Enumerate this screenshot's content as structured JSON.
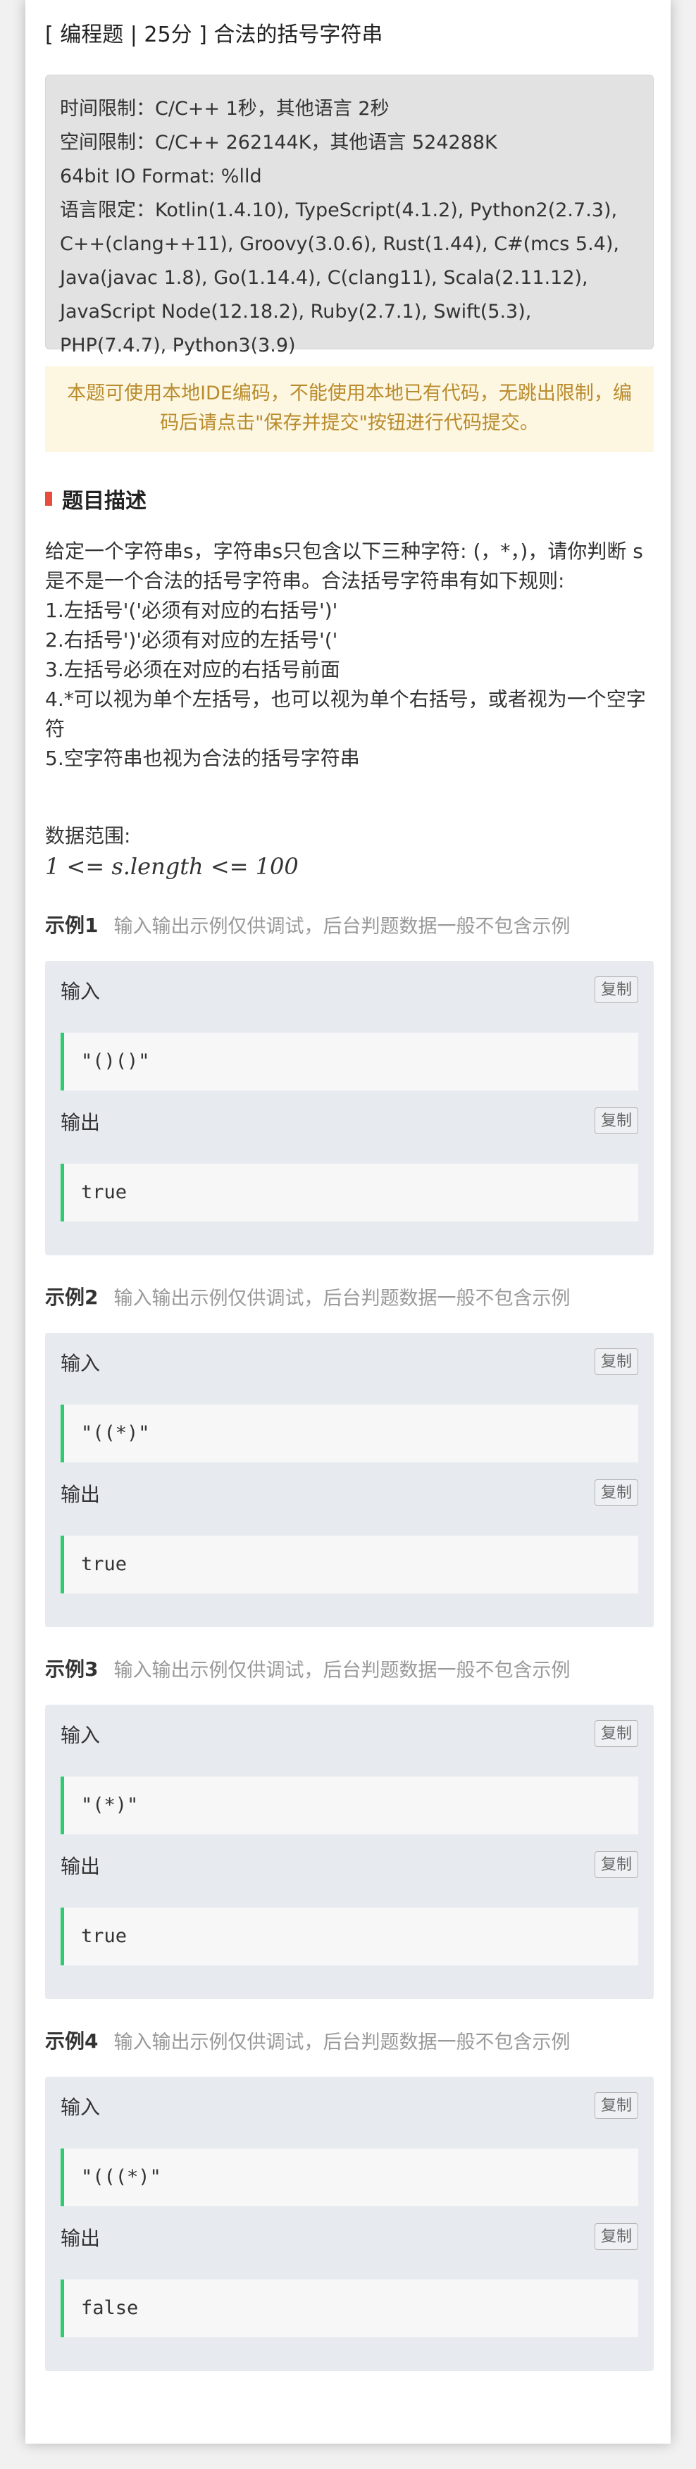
{
  "title": "[ 编程题 | 25分 ] 合法的括号字符串",
  "limits": [
    "时间限制：C/C++ 1秒，其他语言 2秒",
    "空间限制：C/C++ 262144K，其他语言 524288K",
    "64bit IO Format: %lld",
    "语言限定：Kotlin(1.4.10), TypeScript(4.1.2), Python2(2.7.3), C++(clang++11), Groovy(3.0.6), Rust(1.44), C#(mcs 5.4), Java(javac 1.8), Go(1.14.4), C(clang11), Scala(2.11.12), JavaScript Node(12.18.2), Ruby(2.7.1), Swift(5.3), PHP(7.4.7), Python3(3.9)"
  ],
  "notice": "本题可使用本地IDE编码，不能使用本地已有代码，无跳出限制，编码后请点击\"保存并提交\"按钮进行代码提交。",
  "section_title": "题目描述",
  "description": [
    "给定一个字符串s，字符串s只包含以下三种字符: (，*，)，请你判断 s是不是一个合法的括号字符串。合法括号字符串有如下规则:",
    "1.左括号'('必须有对应的右括号')'",
    "2.右括号')'必须有对应的左括号'('",
    "3.左括号必须在对应的右括号前面",
    "4.*可以视为单个左括号，也可以视为单个右括号，或者视为一个空字符",
    "5.空字符串也视为合法的括号字符串"
  ],
  "range_label": "数据范围:",
  "range_math": "1 <= s.length <= 100",
  "examples": [
    {
      "title": "示例1",
      "note": "输入输出示例仅供调试，后台判题数据一般不包含示例",
      "input_label": "输入",
      "output_label": "输出",
      "copy": "复制",
      "input": "\"()()\"",
      "output": "true"
    },
    {
      "title": "示例2",
      "note": "输入输出示例仅供调试，后台判题数据一般不包含示例",
      "input_label": "输入",
      "output_label": "输出",
      "copy": "复制",
      "input": "\"((*)\"",
      "output": "true"
    },
    {
      "title": "示例3",
      "note": "输入输出示例仅供调试，后台判题数据一般不包含示例",
      "input_label": "输入",
      "output_label": "输出",
      "copy": "复制",
      "input": "\"(*)\"",
      "output": "true"
    },
    {
      "title": "示例4",
      "note": "输入输出示例仅供调试，后台判题数据一般不包含示例",
      "input_label": "输入",
      "output_label": "输出",
      "copy": "复制",
      "input": "\"(((*)\"",
      "output": "false"
    }
  ],
  "colors": {
    "accent_red": "#e74c3c",
    "code_border": "#2ecc71",
    "notice_text": "#b98b2c"
  }
}
